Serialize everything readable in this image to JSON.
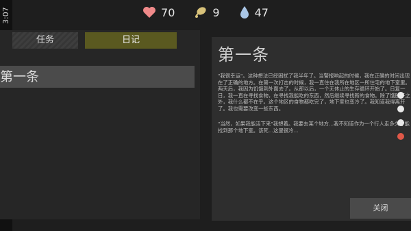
{
  "status": {
    "time": "3:07"
  },
  "resources": {
    "health": {
      "value": "70",
      "icon": "heart-icon",
      "color": "#f08a8a"
    },
    "food": {
      "value": "9",
      "icon": "food-icon",
      "color": "#d8c27a"
    },
    "water": {
      "value": "47",
      "icon": "water-drop-icon",
      "color": "#a9c6e6"
    }
  },
  "tabs": {
    "task": "任务",
    "diary": "日记"
  },
  "entries": [
    {
      "label": "第一条"
    }
  ],
  "detail": {
    "title": "第一条",
    "paragraphs": [
      "\"我很幸运\"。这种想法已经困扰了我半年了。当警报响起的时候，我在正确的时间出现在了正确的地方。在第一次打击的时候，我一直住在我所在地区一所住宅的地下室里。两天后，我因为饥饿到外面去了。从那以后，一个无休止的生存循环开始了。日复一日，我一直在寻找食物，在寻找我能吃的东西，然后继续寻找新的食物。除了饿肚子之外，我什么都不在乎。这个地区的食物都吃完了，地下室也变冷了。我知道我得离开了。我也需要改变一些东西。",
      "\"当然，如果我能活下来\"我想着。我要去某个地方...我不知道作为一个行人走多久才能找到那个地下室。该死...这里很冷..."
    ]
  },
  "buttons": {
    "close": "关闭"
  }
}
